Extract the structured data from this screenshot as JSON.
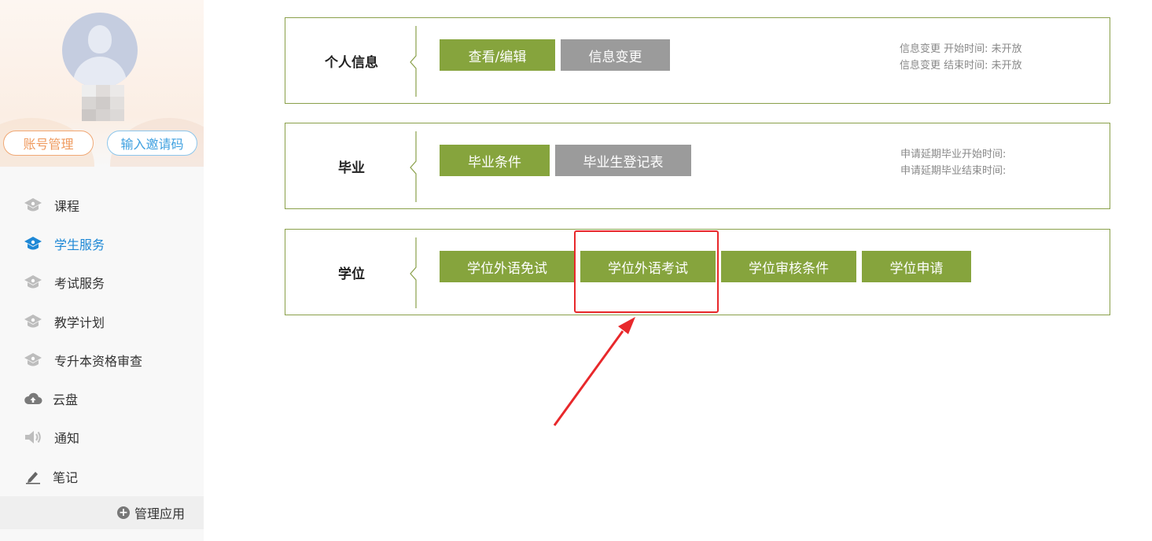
{
  "sidebar": {
    "account_button": "账号管理",
    "invite_button": "输入邀请码",
    "items": [
      {
        "label": "课程",
        "icon": "graduation-cap-icon",
        "active": false
      },
      {
        "label": "学生服务",
        "icon": "graduation-cap-icon",
        "active": true
      },
      {
        "label": "考试服务",
        "icon": "graduation-cap-icon",
        "active": false
      },
      {
        "label": "教学计划",
        "icon": "graduation-cap-icon",
        "active": false
      },
      {
        "label": "专升本资格审查",
        "icon": "graduation-cap-icon",
        "active": false
      },
      {
        "label": "云盘",
        "icon": "cloud-upload-icon",
        "active": false
      },
      {
        "label": "通知",
        "icon": "speaker-icon",
        "active": false
      },
      {
        "label": "笔记",
        "icon": "pen-icon",
        "active": false
      }
    ],
    "manage_apps": "管理应用"
  },
  "sections": {
    "personal": {
      "title": "个人信息",
      "buttons": [
        "查看/编辑",
        "信息变更"
      ],
      "meta": [
        "信息变更 开始时间: 未开放",
        "信息变更 结束时间: 未开放"
      ]
    },
    "graduation": {
      "title": "毕业",
      "buttons": [
        "毕业条件",
        "毕业生登记表"
      ],
      "meta": [
        "申请延期毕业开始时间:",
        "申请延期毕业结束时间:"
      ]
    },
    "degree": {
      "title": "学位",
      "buttons": [
        "学位外语免试",
        "学位外语考试",
        "学位审核条件",
        "学位申请"
      ]
    }
  },
  "colors": {
    "accent_green": "#86a43d",
    "button_gray": "#9b9b9b",
    "active_blue": "#1e88d6",
    "annotation_red": "#e8282b"
  }
}
